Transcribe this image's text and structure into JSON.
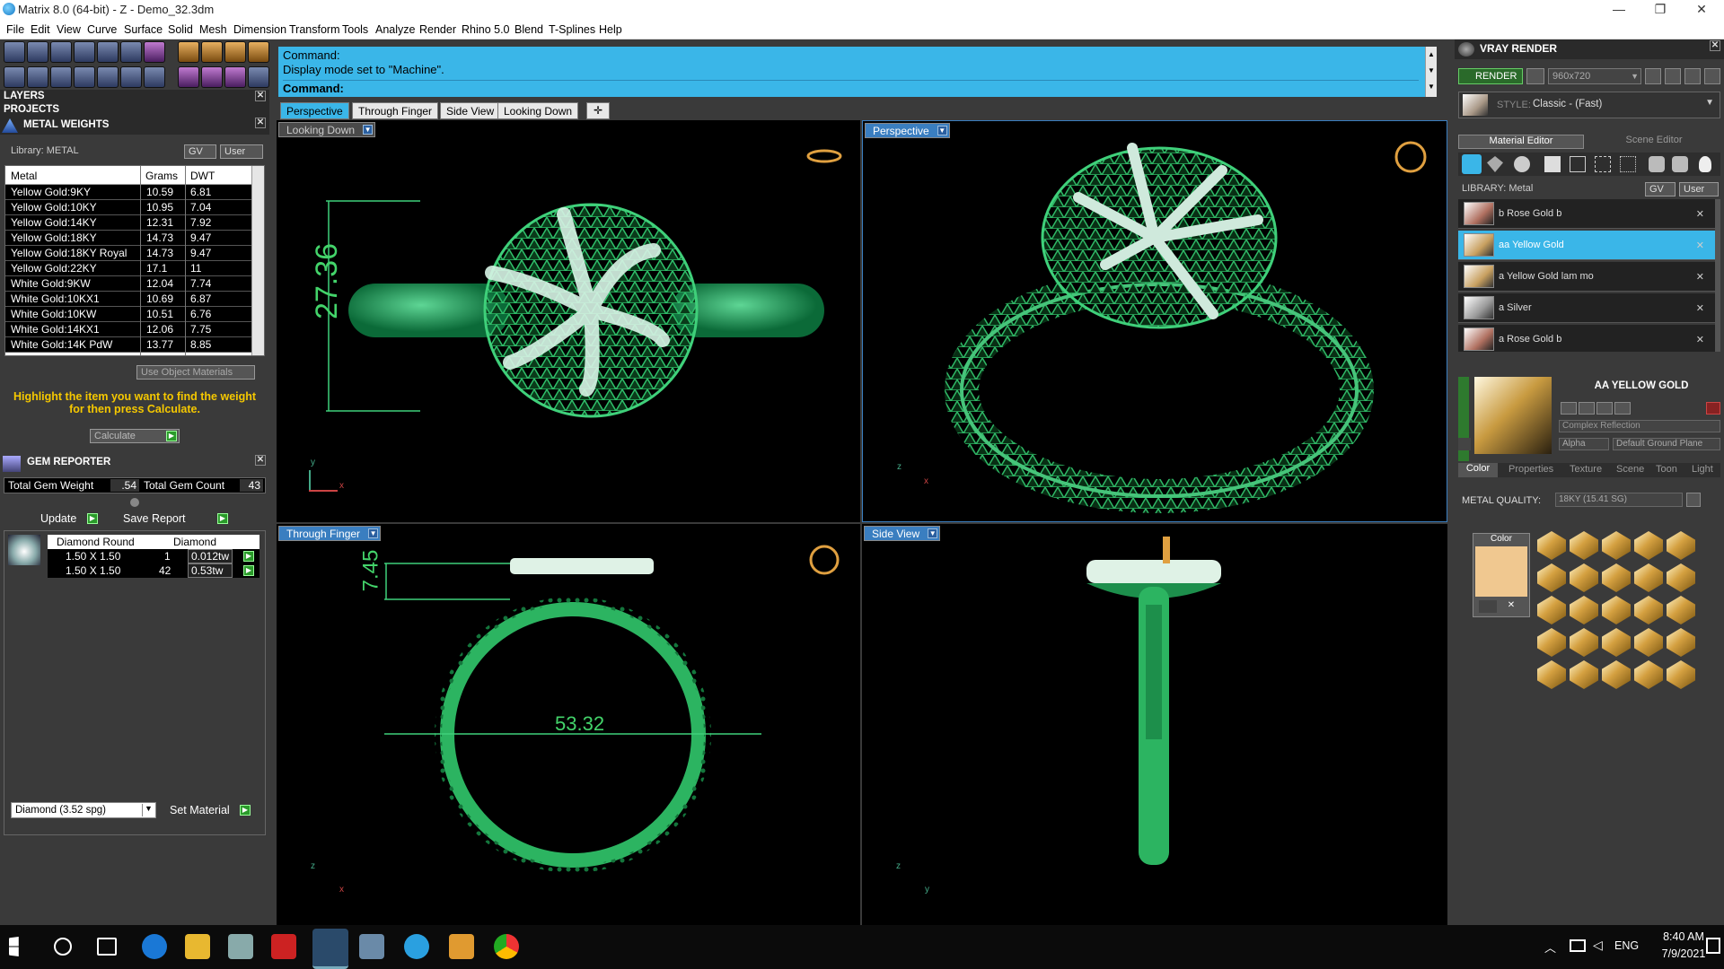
{
  "window": {
    "title": "Matrix 8.0 (64-bit) - Z - Demo_32.3dm"
  },
  "menu": [
    "File",
    "Edit",
    "View",
    "Curve",
    "Surface",
    "Solid",
    "Mesh",
    "Dimension",
    "Transform",
    "Tools",
    "Analyze",
    "Render",
    "Rhino 5.0",
    "Blend",
    "T-Splines",
    "Help"
  ],
  "left": {
    "layers_label": "LAYERS",
    "projects_label": "PROJECTS",
    "metal_weights_label": "METAL WEIGHTS",
    "library_label": "Library: METAL",
    "gv_label": "GV",
    "user_label": "User",
    "metal_table": {
      "headers": [
        "Metal",
        "Grams",
        "DWT"
      ],
      "rows": [
        [
          "Yellow Gold:9KY",
          "10.59",
          "6.81"
        ],
        [
          "Yellow Gold:10KY",
          "10.95",
          "7.04"
        ],
        [
          "Yellow Gold:14KY",
          "12.31",
          "7.92"
        ],
        [
          "Yellow Gold:18KY",
          "14.73",
          "9.47"
        ],
        [
          "Yellow Gold:18KY Royal",
          "14.73",
          "9.47"
        ],
        [
          "Yellow Gold:22KY",
          "17.1",
          "11"
        ],
        [
          "White Gold:9KW",
          "12.04",
          "7.74"
        ],
        [
          "White Gold:10KX1",
          "10.69",
          "6.87"
        ],
        [
          "White Gold:10KW",
          "10.51",
          "6.76"
        ],
        [
          "White Gold:14KX1",
          "12.06",
          "7.75"
        ],
        [
          "White Gold:14K PdW",
          "13.77",
          "8.85"
        ]
      ]
    },
    "use_object_materials": "Use Object Materials",
    "highlight_msg": "Highlight the item you want to find the weight for then press Calculate.",
    "calculate_label": "Calculate",
    "gem_reporter_label": "GEM REPORTER",
    "total_gem_weight_label": "Total Gem Weight",
    "total_gem_weight_value": ".54",
    "total_gem_count_label": "Total Gem Count",
    "total_gem_count_value": "43",
    "update_label": "Update",
    "save_report_label": "Save Report",
    "gem_table": {
      "headers": [
        "Diamond Round",
        "Diamond"
      ],
      "rows": [
        [
          "1.50 X 1.50",
          "1",
          "0.012tw"
        ],
        [
          "1.50 X 1.50",
          "42",
          "0.53tw"
        ]
      ]
    },
    "material_select": "Diamond    (3.52 spg)",
    "set_material_label": "Set Material"
  },
  "command": {
    "line1": "Command:",
    "line2": "Display mode set to \"Machine\".",
    "prompt": "Command:"
  },
  "tabs": [
    "Perspective",
    "Through Finger",
    "Side View",
    "Looking Down"
  ],
  "viewports": {
    "tl": {
      "label": "Looking Down",
      "dimension": "27.36",
      "axis1": "y",
      "axis2": "x"
    },
    "tr": {
      "label": "Perspective",
      "axis1": "z",
      "axis2": "x"
    },
    "bl": {
      "label": "Through Finger",
      "dim_height": "7.45",
      "dim_width": "53.32",
      "axis1": "z",
      "axis2": "x"
    },
    "br": {
      "label": "Side View",
      "axis1": "z",
      "axis2": "y"
    }
  },
  "right": {
    "vray_label": "VRAY RENDER",
    "render_label": "RENDER",
    "resolution": "960x720",
    "style_label": "STYLE:",
    "style_value": "Classic - (Fast)",
    "material_editor_tab": "Material Editor",
    "scene_editor_tab": "Scene Editor",
    "library_label": "LIBRARY: Metal",
    "gv_label": "GV",
    "user_label": "User",
    "materials": [
      "b Rose Gold b",
      "aa Yellow Gold",
      "a Yellow Gold lam mo",
      "a Silver",
      "a Rose Gold b"
    ],
    "selected_material": "AA YELLOW GOLD",
    "reflection_select": "Complex Reflection",
    "alpha_label": "Alpha",
    "ground_select": "Default Ground Plane",
    "prop_tabs": [
      "Color",
      "Properties",
      "Texture",
      "Scene",
      "Toon",
      "Light"
    ],
    "metal_quality_label": "METAL QUALITY:",
    "metal_quality_value": "18KY         (15.41 SG)",
    "color_label": "Color",
    "accent_color": "#f0c890"
  },
  "taskbar": {
    "lang": "ENG",
    "time": "8:40 AM",
    "date": "7/9/2021"
  }
}
